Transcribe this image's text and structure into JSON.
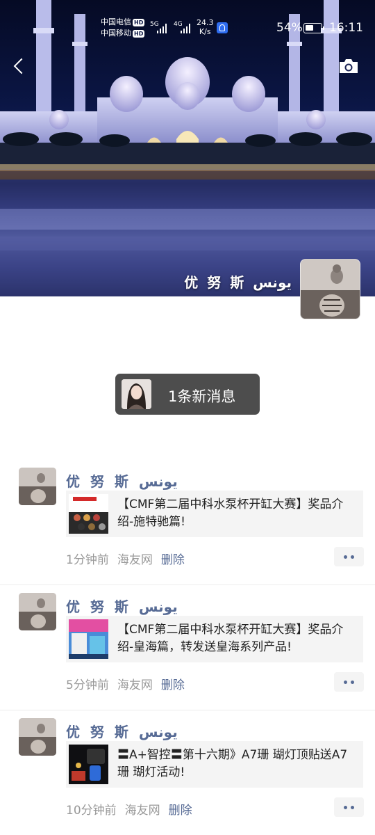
{
  "status_bar": {
    "carrier_1": "中国电信",
    "carrier_2": "中国移动",
    "hd": "HD",
    "net_1": "5G",
    "net_2": "4G",
    "speed_value": "24.3",
    "speed_unit": "K/s",
    "battery": "54%",
    "battery_level": 0.54,
    "time": "16:11"
  },
  "header": {
    "back_icon": "chevron-left-icon",
    "camera_icon": "camera-icon"
  },
  "profile": {
    "name": "优 努 斯  يونس"
  },
  "new_message": {
    "label": "1条新消息"
  },
  "colors": {
    "link": "#576b95",
    "meta": "#999999",
    "card_bg": "#f4f4f4",
    "pill_bg": "#4d4d4d"
  },
  "posts": [
    {
      "author": "优 努 斯  يونس",
      "title": "【CMF第二届中科水泵杯开缸大赛】奖品介绍-施特驰篇!",
      "time": "1分钟前",
      "source": "海友网",
      "delete": "删除"
    },
    {
      "author": "优 努 斯  يونس",
      "title": "【CMF第二届中科水泵杯开缸大赛】奖品介绍-皇海篇，转发送皇海系列产品!",
      "time": "5分钟前",
      "source": "海友网",
      "delete": "删除"
    },
    {
      "author": "优 努 斯  يونس",
      "title": "〓A+智控〓第十六期》A7珊 瑚灯顶贴送A7珊 瑚灯活动!",
      "time": "10分钟前",
      "source": "海友网",
      "delete": "删除"
    }
  ]
}
